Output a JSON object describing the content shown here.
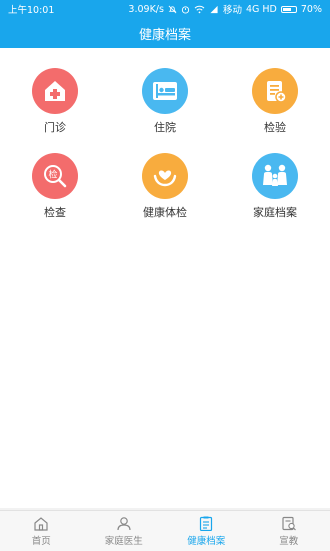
{
  "status_bar": {
    "time": "上午10:01",
    "network_speed": "3.09K/s",
    "carrier": "移动",
    "network": "4G HD",
    "battery": "70%",
    "battery_level": 0.7
  },
  "header": {
    "title": "健康档案"
  },
  "grid": {
    "items": [
      {
        "label": "门诊",
        "color": "#f36c6c",
        "icon": "clinic-icon"
      },
      {
        "label": "住院",
        "color": "#49b8f0",
        "icon": "bed-icon"
      },
      {
        "label": "检验",
        "color": "#f8ac3e",
        "icon": "lab-report-icon"
      },
      {
        "label": "检查",
        "color": "#f36c6c",
        "icon": "exam-search-icon"
      },
      {
        "label": "健康体检",
        "color": "#f8ac3e",
        "icon": "heart-hands-icon"
      },
      {
        "label": "家庭档案",
        "color": "#49b8f0",
        "icon": "family-icon"
      }
    ],
    "exam_badge": "检"
  },
  "tabbar": {
    "tabs": [
      {
        "label": "首页",
        "icon": "home-icon"
      },
      {
        "label": "家庭医生",
        "icon": "doctor-icon"
      },
      {
        "label": "健康档案",
        "icon": "records-icon",
        "active": true
      },
      {
        "label": "宣教",
        "icon": "education-icon"
      }
    ]
  },
  "colors": {
    "brand": "#19a6ec",
    "tab_inactive": "#888888"
  }
}
